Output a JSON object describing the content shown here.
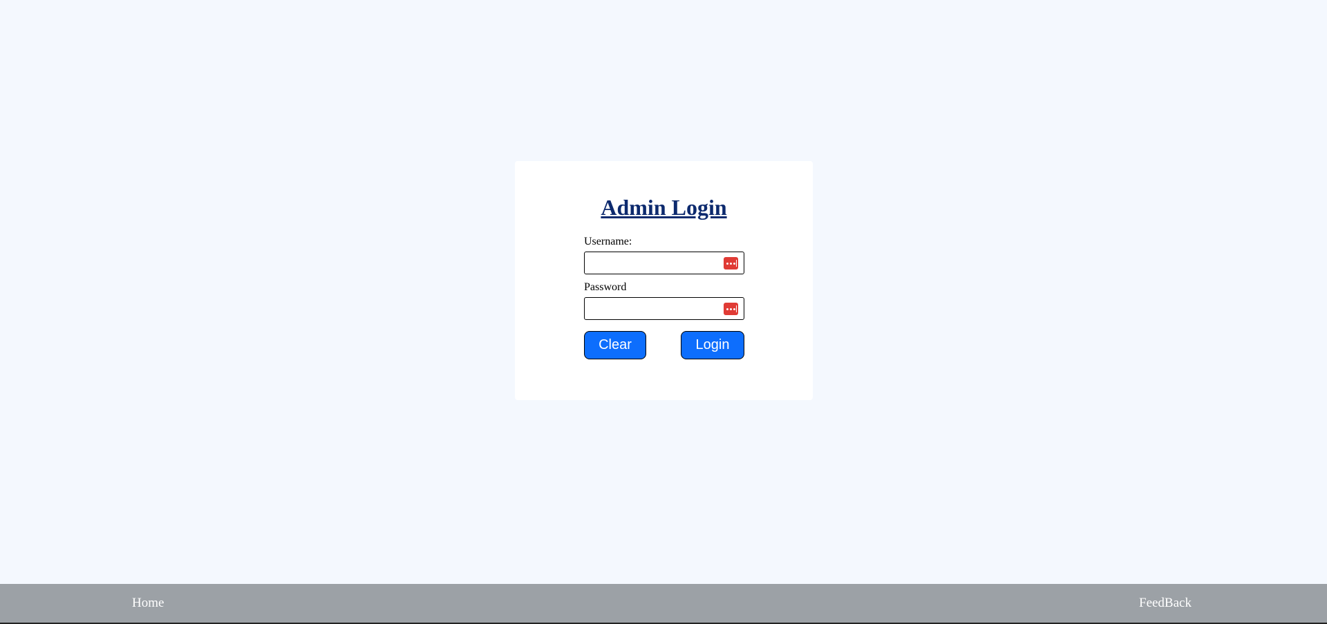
{
  "login": {
    "title": "Admin Login",
    "username_label": "Username:",
    "username_value": "",
    "password_label": "Password",
    "password_value": "",
    "password_manager_icon": "password-manager-icon",
    "clear_label": "Clear",
    "login_label": "Login"
  },
  "footer": {
    "home_label": "Home",
    "feedback_label": "FeedBack"
  },
  "colors": {
    "background": "#f4f8fe",
    "title": "#0d2a6e",
    "button": "#0d6efd",
    "footer": "#9ca1a6",
    "password_manager_icon": "#e03b35"
  }
}
